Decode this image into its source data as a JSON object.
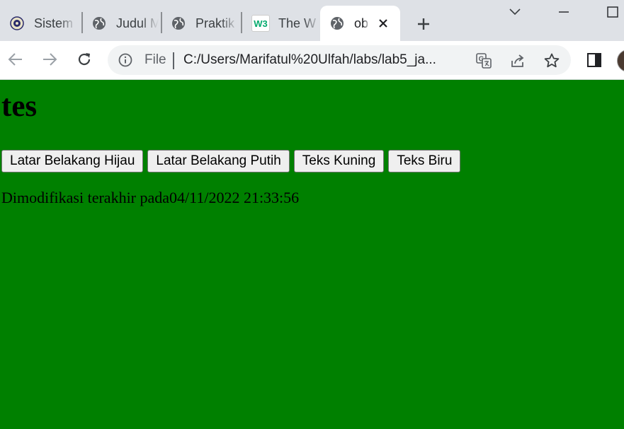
{
  "tabs": [
    {
      "title": "Sistem",
      "icon": "university-seal-icon"
    },
    {
      "title": "Judul M",
      "icon": "globe-icon"
    },
    {
      "title": "Praktik",
      "icon": "globe-icon"
    },
    {
      "title": "The W",
      "icon": "w3schools-icon",
      "favicon_text": "W3"
    },
    {
      "title": "ob",
      "icon": "globe-icon",
      "active": true
    }
  ],
  "omnibox": {
    "scheme_label": "File",
    "url": "C:/Users/Marifatul%20Ulfah/labs/lab5_ja..."
  },
  "page": {
    "heading": "tes",
    "buttons": [
      "Latar Belakang Hijau",
      "Latar Belakang Putih",
      "Teks Kuning",
      "Teks Biru"
    ],
    "modified_text": "Dimodifikasi terakhir pada04/11/2022 21:33:56",
    "background_color": "#008000"
  },
  "colors": {
    "tabstrip": "#dee1e6",
    "toolbar": "#ffffff",
    "omnibox": "#f1f3f4",
    "w3_brand": "#04aa6d"
  }
}
